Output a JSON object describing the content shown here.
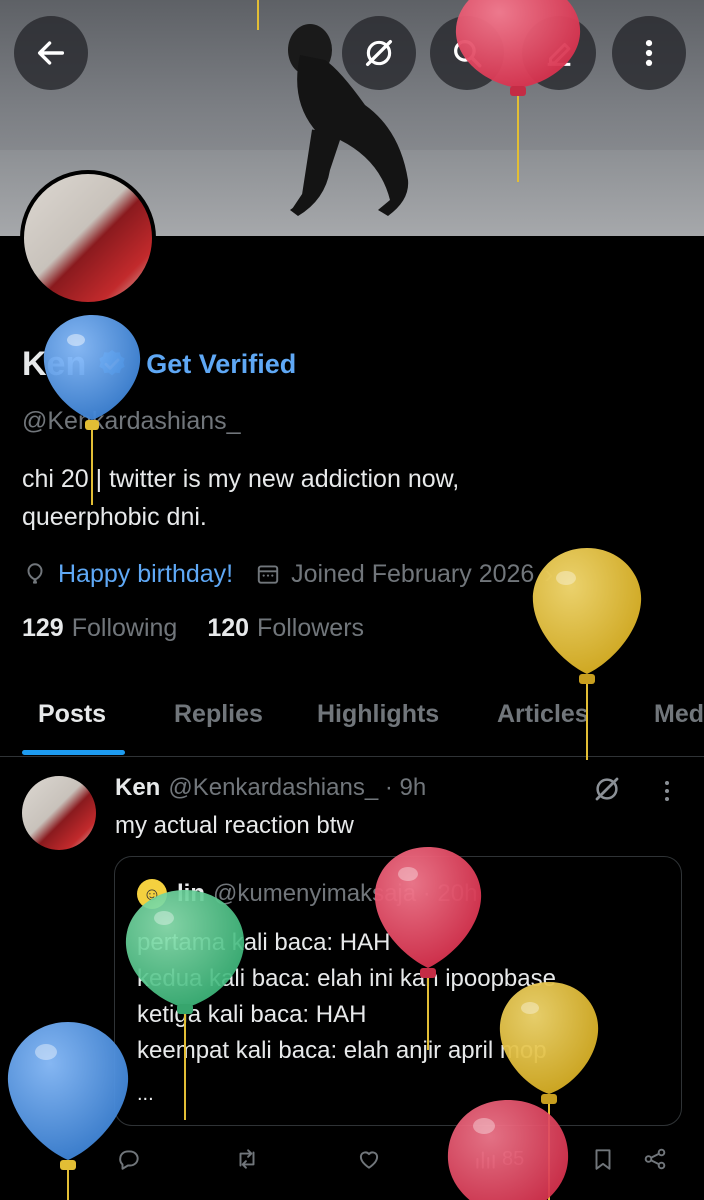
{
  "profile": {
    "display_name": "Ken",
    "get_verified_label": "Get Verified",
    "handle": "@Kenkardashians_",
    "bio_line1": "chi 20 | twitter is my new addiction now,",
    "bio_line2": "queerphobic dni.",
    "birthday_label": "Happy birthday!",
    "joined_label": "Joined February 2026",
    "following_count": "129",
    "following_label": "Following",
    "followers_count": "120",
    "followers_label": "Followers"
  },
  "header_icons": [
    "back-arrow-icon",
    "grok-icon",
    "search-icon",
    "compose-icon",
    "more-vertical-icon"
  ],
  "tabs": [
    {
      "label": "Posts",
      "active": true
    },
    {
      "label": "Replies",
      "active": false
    },
    {
      "label": "Highlights",
      "active": false
    },
    {
      "label": "Articles",
      "active": false
    },
    {
      "label": "Media",
      "active": false
    }
  ],
  "post": {
    "author_name": "Ken",
    "author_handle_time": "@Kenkardashians_ · 9h",
    "text": "my actual reaction btw",
    "quote": {
      "author_name": "lin",
      "author_handle_time": "@kumenyimaksaja · 20h",
      "lines": [
        "pertama kali baca: HAH",
        "kedua kali baca: elah ini kan ipoopbase",
        "ketiga kali baca: HAH",
        "keempat kali baca: elah anjir april mop"
      ],
      "ellipsis": "..."
    },
    "views_count": "85"
  },
  "colors": {
    "accent": "#1d9bf0",
    "link": "#5fa8f5",
    "muted": "#71767b",
    "balloon_blue": "#4a8fe0",
    "balloon_red": "#e0435c",
    "balloon_yellow": "#e2be35",
    "balloon_green": "#4fc48a"
  }
}
